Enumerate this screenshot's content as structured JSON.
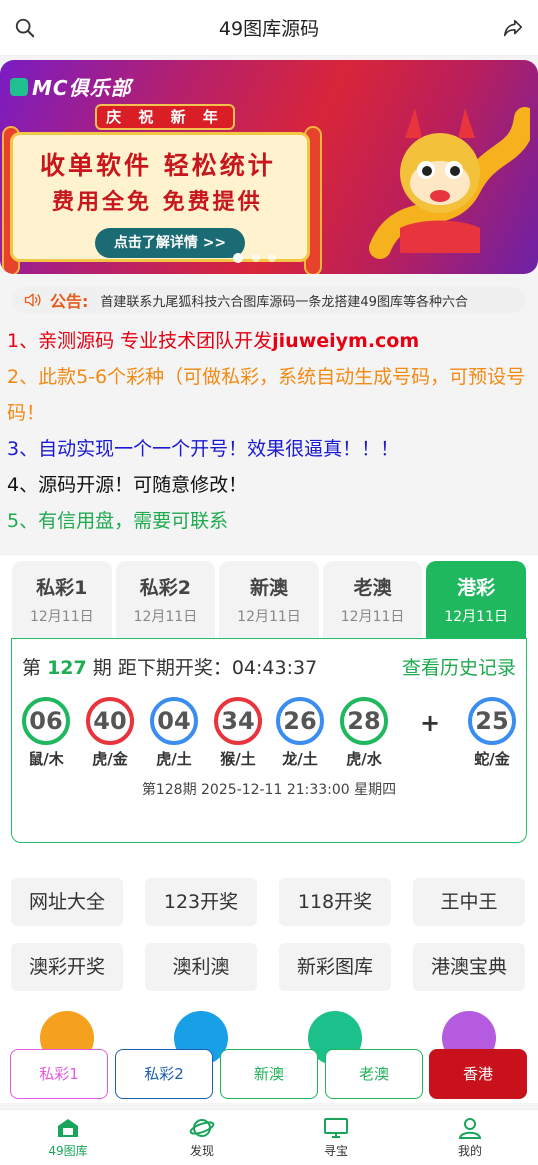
{
  "header": {
    "title": "49图库源码"
  },
  "banner": {
    "brand": "MC俱乐部",
    "scroll_title": "庆 祝 新 年",
    "line1": "收单软件 轻松统计",
    "line2": "费用全免 免费提供",
    "cta": "点击了解详情 >>"
  },
  "notice": {
    "label": "公告:",
    "text": "首建联系九尾狐科技六合图库源码一条龙搭建49图库等各种六合"
  },
  "intro": {
    "l1_prefix": "1、亲测源码 专业技术团队开发",
    "l1_site": "jiuweiym.com",
    "l2": "2、此款5-6个彩种（可做私彩，系统自动生成号码，可预设号码！",
    "l3": "3、自动实现一个一个开号！效果很逼真！！！",
    "l4": "4、源码开源！可随意修改！",
    "l5": "5、有信用盘，需要可联系"
  },
  "lottery": {
    "tabs": [
      {
        "name": "私彩1",
        "date": "12月11日"
      },
      {
        "name": "私彩2",
        "date": "12月11日"
      },
      {
        "name": "新澳",
        "date": "12月11日"
      },
      {
        "name": "老澳",
        "date": "12月11日"
      },
      {
        "name": "港彩",
        "date": "12月11日"
      }
    ],
    "draw_prefix": "第",
    "draw_number": "127",
    "draw_suffix": "期 距下期开奖：04:43:37",
    "history": "查看历史记录",
    "balls": [
      {
        "num": "06",
        "zodiac": "鼠/木",
        "color": "#1fb85f"
      },
      {
        "num": "40",
        "zodiac": "虎/金",
        "color": "#e8343c"
      },
      {
        "num": "04",
        "zodiac": "虎/土",
        "color": "#3b8ef0"
      },
      {
        "num": "34",
        "zodiac": "猴/土",
        "color": "#e8343c"
      },
      {
        "num": "26",
        "zodiac": "龙/土",
        "color": "#3b8ef0"
      },
      {
        "num": "28",
        "zodiac": "虎/水",
        "color": "#1fb85f"
      }
    ],
    "plus": "+",
    "special": {
      "num": "25",
      "zodiac": "蛇/金",
      "color": "#3b8ef0"
    },
    "next_draw": "第128期 2025-12-11 21:33:00 星期四"
  },
  "links": [
    "网址大全",
    "123开奖",
    "118开奖",
    "王中王",
    "澳彩开奖",
    "澳利澳",
    "新彩图库",
    "港澳宝典"
  ],
  "quick_tabs": [
    {
      "label": "私彩1",
      "color": "#e45be0"
    },
    {
      "label": "私彩2",
      "color": "#1d5fb0"
    },
    {
      "label": "新澳",
      "color": "#22b45a"
    },
    {
      "label": "老澳",
      "color": "#22b45a"
    },
    {
      "label": "香港",
      "color": "#ffffff"
    }
  ],
  "bottom_nav": [
    "49图库",
    "发现",
    "寻宝",
    "我的"
  ]
}
